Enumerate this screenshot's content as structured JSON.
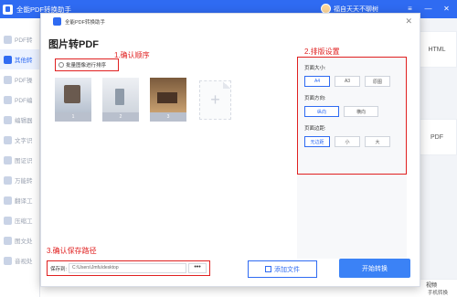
{
  "app": {
    "title": "全能PDF转换助手",
    "user_name": "福自天天不聊树"
  },
  "window_controls": {
    "menu": "≡",
    "minimize": "—",
    "close": "✕"
  },
  "sidebar": {
    "items": [
      {
        "label": "PDF转"
      },
      {
        "label": "其他转"
      },
      {
        "label": "PDF操"
      },
      {
        "label": "PDF编"
      },
      {
        "label": "编辑器"
      },
      {
        "label": "文字识"
      },
      {
        "label": "图证识"
      },
      {
        "label": "万能转"
      },
      {
        "label": "翻译工"
      },
      {
        "label": "压缩工"
      },
      {
        "label": "图文处"
      },
      {
        "label": "音视处"
      }
    ]
  },
  "background": {
    "card_html": "HTML",
    "card_pdf": "PDF",
    "bottom_right_1": "视频",
    "bottom_right_2": "手机转换"
  },
  "dialog": {
    "title": "全能PDF转换助手",
    "close": "✕",
    "heading": "图片转PDF",
    "step1": "1.确认顺序",
    "step2": "2.排版设置",
    "step3": "3.确认保存路径",
    "sort_button": "批量图像进行排序",
    "thumbnails": [
      {
        "num": "1"
      },
      {
        "num": "2"
      },
      {
        "num": "3"
      }
    ],
    "add_page": "+",
    "settings": {
      "page_size_label": "页面大小:",
      "page_size_options": [
        "A4",
        "A3",
        "原图"
      ],
      "orientation_label": "页面方向:",
      "orientation_options": [
        "纵向",
        "横向"
      ],
      "margin_label": "页面边距:",
      "margin_options": [
        "无边距",
        "小",
        "大"
      ]
    },
    "save_label": "保存到:",
    "save_path": "C:\\Users\\Jmfu\\desktop",
    "browse": "•••",
    "add_file": "添加文件",
    "convert": "开始转换"
  }
}
